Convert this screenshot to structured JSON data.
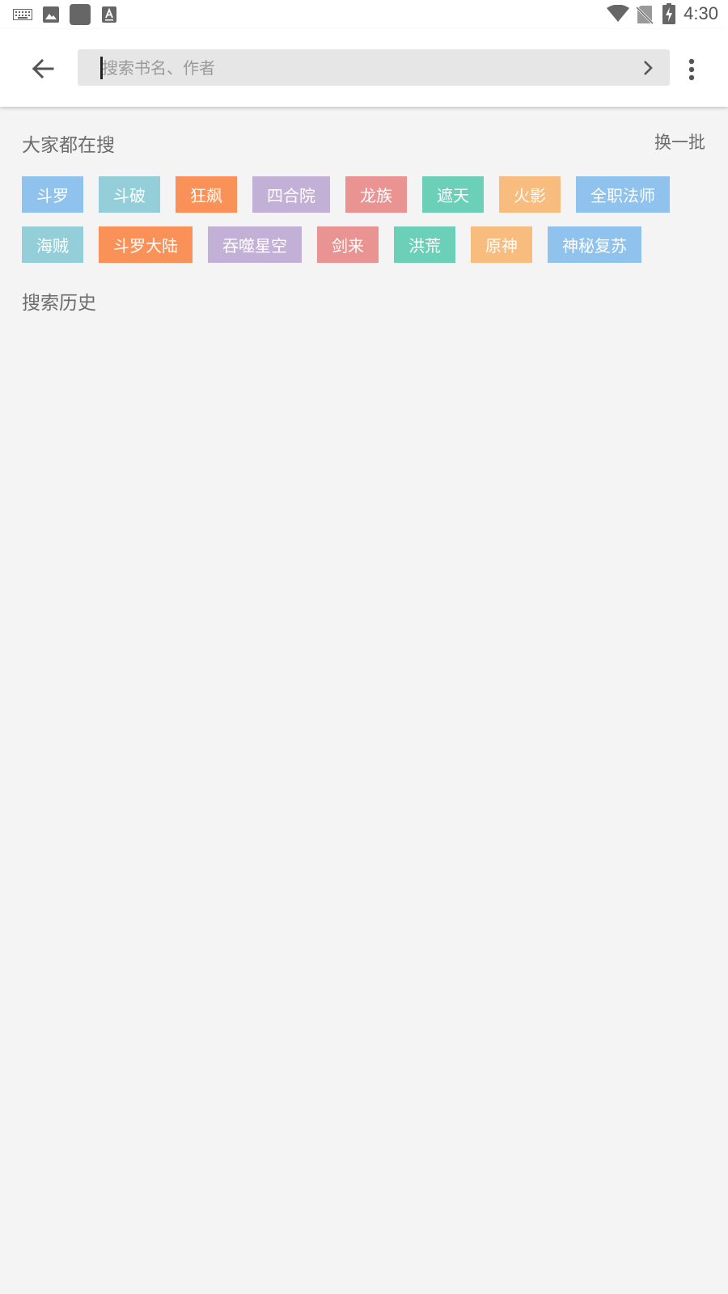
{
  "status_bar": {
    "time": "4:30",
    "icons": [
      "keyboard-icon",
      "image-icon",
      "app-square-icon",
      "text-a-icon",
      "wifi-icon",
      "no-sim-icon",
      "battery-charging-icon"
    ]
  },
  "toolbar": {
    "back_icon": "arrow-left-icon",
    "search_placeholder": "搜索书名、作者",
    "search_value": "",
    "submit_icon": "chevron-right-icon",
    "more_icon": "more-vert-icon"
  },
  "hot_search": {
    "title": "大家都在搜",
    "refresh_label": "换一批",
    "tags": [
      {
        "label": "斗罗",
        "color": "#90c2ee"
      },
      {
        "label": "斗破",
        "color": "#94ced8"
      },
      {
        "label": "狂飙",
        "color": "#f99159"
      },
      {
        "label": "四合院",
        "color": "#c2b0d6"
      },
      {
        "label": "龙族",
        "color": "#e99392"
      },
      {
        "label": "遮天",
        "color": "#6ccfb7"
      },
      {
        "label": "火影",
        "color": "#f8bc7e"
      },
      {
        "label": "全职法师",
        "color": "#90c2ee"
      },
      {
        "label": "海贼",
        "color": "#94ced8"
      },
      {
        "label": "斗罗大陆",
        "color": "#f99159"
      },
      {
        "label": "吞噬星空",
        "color": "#c2b0d6"
      },
      {
        "label": "剑来",
        "color": "#e99392"
      },
      {
        "label": "洪荒",
        "color": "#6ccfb7"
      },
      {
        "label": "原神",
        "color": "#f8bc7e"
      },
      {
        "label": "神秘复苏",
        "color": "#90c2ee"
      }
    ]
  },
  "history": {
    "title": "搜索历史",
    "items": []
  }
}
